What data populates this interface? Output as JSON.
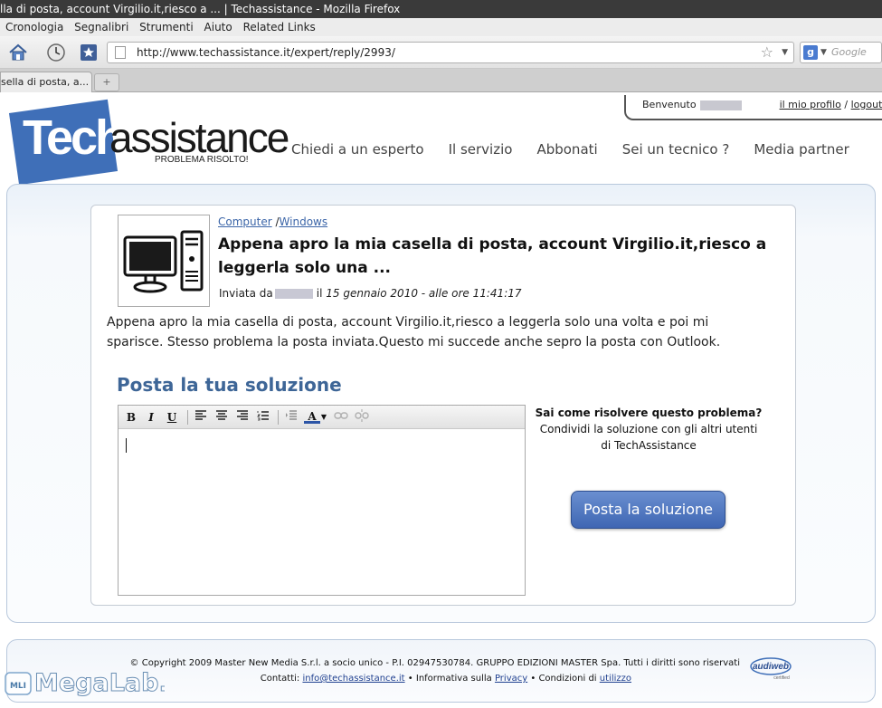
{
  "browser": {
    "window_title": "lla di posta, account Virgilio.it,riesco a ... | Techassistance - Mozilla Firefox",
    "menu": [
      "Cronologia",
      "Segnalibri",
      "Strumenti",
      "Aiuto",
      "Related Links"
    ],
    "url": "http://www.techassistance.it/expert/reply/2993/",
    "search_placeholder": "Google",
    "tab_label": "sella di posta, a...",
    "new_tab_symbol": "+"
  },
  "header": {
    "logo_part1": "Tech",
    "logo_part2": "assistance",
    "logo_tagline": "PROBLEMA RISOLTO!",
    "welcome": "Benvenuto",
    "profile_link": "il mio profilo",
    "separator": "/",
    "logout_link": "logout",
    "nav": [
      "Chiedi a un esperto",
      "Il servizio",
      "Abbonati",
      "Sei un tecnico ?",
      "Media partner"
    ]
  },
  "question": {
    "category": "Computer",
    "crumb_sep": "/",
    "subcategory": "Windows",
    "title": "Appena apro la mia casella di posta, account Virgilio.it,riesco a leggerla solo una ...",
    "sent_by": "Inviata da",
    "date_prefix": "il",
    "date": "15 gennaio 2010 - alle ore 11:41:17",
    "body": "Appena apro la mia casella di posta, account Virgilio.it,riesco a leggerla solo una volta e poi mi sparisce. Stesso problema la posta inviata.Questo mi succede anche sepro la posta con Outlook."
  },
  "answer": {
    "heading": "Posta la tua soluzione",
    "help_title": "Sai come risolvere questo problema?",
    "help_text": "Condividi la soluzione con gli altri utenti di TechAssistance",
    "submit_label": "Posta la soluzione",
    "toolbar": {
      "bold": "B",
      "italic": "I",
      "underline": "U",
      "font_color": "A"
    }
  },
  "footer": {
    "line1": "© Copyright 2009 Master New Media S.r.l. a socio unico - P.I. 02947530784. GRUPPO EDIZIONI MASTER Spa. Tutti i diritti sono riservati",
    "contacts_label": "Contatti:",
    "email": "info@techassistance.it",
    "bullet": "•",
    "privacy_label": "Informativa sulla",
    "privacy_link": "Privacy",
    "conditions_label": "Condizioni di",
    "conditions_link": "utilizzo",
    "audiweb": "audiweb",
    "audiweb_sub": "certified"
  },
  "watermark": {
    "text": "MegaLab.it",
    "badge": "MLI"
  },
  "colors": {
    "brand_blue": "#3f6fb8",
    "heading_blue": "#3e6697",
    "button_blue": "#4a72bd"
  }
}
